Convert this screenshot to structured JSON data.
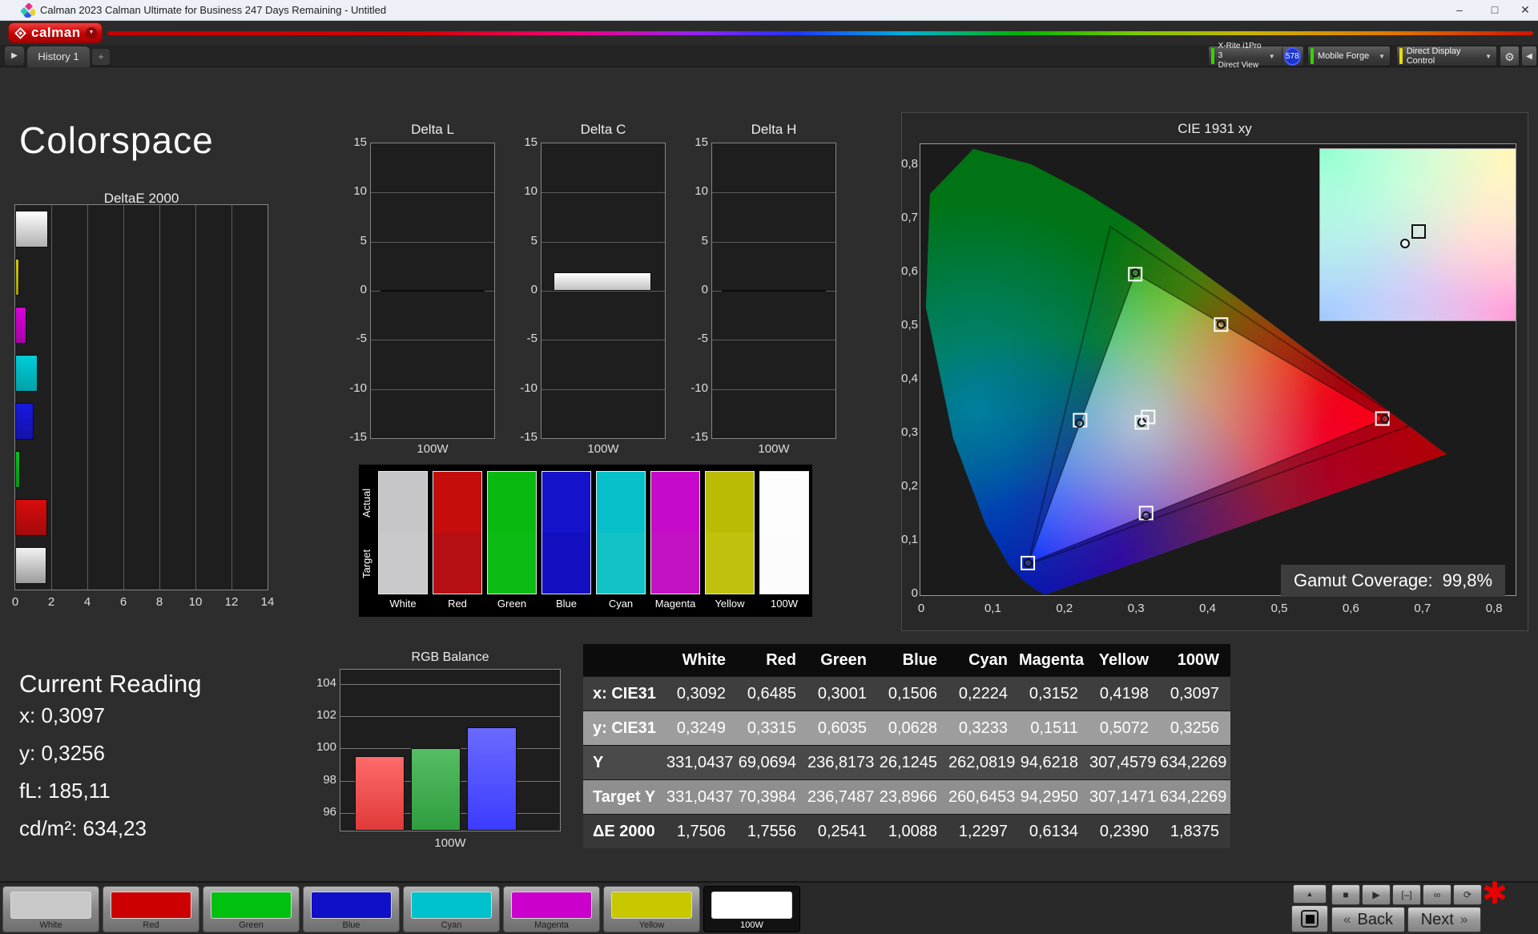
{
  "window": {
    "title": "Calman 2023 Calman Ultimate for Business 247 Days Remaining  - Untitled",
    "minimize": "–",
    "maximize": "□",
    "close": "✕"
  },
  "brand": {
    "name": "calman",
    "dropdown": "▼"
  },
  "tab_bar": {
    "expander": "▶",
    "tab": "History 1",
    "add": "+",
    "meter": {
      "line1": "X-Rite i1Pro 3",
      "line2": "Direct View",
      "badge": "578",
      "dropdown": "▼",
      "accent": "#35d400"
    },
    "pattern_source": {
      "label": "Mobile Forge",
      "dropdown": "▼",
      "accent": "#35d400"
    },
    "display_control": {
      "label": "Direct Display Control",
      "dropdown": "▼",
      "accent": "#f0dc00"
    },
    "gear": "⚙",
    "collapse": "◀"
  },
  "page_title": "Colorspace",
  "deltae_chart": {
    "type": "bar",
    "title": "DeltaE 2000",
    "xlim": [
      0,
      14
    ],
    "x_ticks": [
      "0",
      "2",
      "4",
      "6",
      "8",
      "10",
      "12",
      "14"
    ],
    "bars_top_to_bottom": [
      {
        "label": "100W",
        "value": 1.8375,
        "c1": "#ffffff",
        "c2": "#b0b0b0"
      },
      {
        "label": "Yellow",
        "value": 0.239,
        "c1": "#d8ca00",
        "c2": "#a89e00"
      },
      {
        "label": "Magenta",
        "value": 0.6134,
        "c1": "#d800d8",
        "c2": "#a800a8"
      },
      {
        "label": "Cyan",
        "value": 1.2297,
        "c1": "#00ccd8",
        "c2": "#00a2aa"
      },
      {
        "label": "Blue",
        "value": 1.0088,
        "c1": "#1818e0",
        "c2": "#1212a8"
      },
      {
        "label": "Green",
        "value": 0.2541,
        "c1": "#00c61e",
        "c2": "#009a16"
      },
      {
        "label": "Red",
        "value": 1.7556,
        "c1": "#d80c0c",
        "c2": "#a40a0a"
      },
      {
        "label": "White",
        "value": 1.7506,
        "c1": "#f2f2f2",
        "c2": "#9c9c9c"
      }
    ]
  },
  "delta_charts": {
    "ylim": [
      -15,
      15
    ],
    "y_ticks": [
      "15",
      "10",
      "5",
      "0",
      "-5",
      "-10",
      "-15"
    ],
    "x_label": "100W",
    "charts": [
      {
        "title": "Delta L",
        "value": 0
      },
      {
        "title": "Delta C",
        "value": 1.9
      },
      {
        "title": "Delta H",
        "value": 0
      }
    ]
  },
  "swatches": {
    "row_labels": [
      "Actual",
      "Target"
    ],
    "items": [
      {
        "label": "White",
        "actual": "#c6c6c8",
        "target": "#c9c9cb"
      },
      {
        "label": "Red",
        "actual": "#c50d0d",
        "target": "#b60f13"
      },
      {
        "label": "Green",
        "actual": "#09b90f",
        "target": "#0cbb13"
      },
      {
        "label": "Blue",
        "actual": "#1512cb",
        "target": "#1310c1"
      },
      {
        "label": "Cyan",
        "actual": "#06c0ca",
        "target": "#12c2c4"
      },
      {
        "label": "Magenta",
        "actual": "#c709c9",
        "target": "#c312c3"
      },
      {
        "label": "Yellow",
        "actual": "#b9bb04",
        "target": "#c0c10c"
      },
      {
        "label": "100W",
        "actual": "#fdfdfd",
        "target": "#fcfcfc"
      }
    ]
  },
  "cie": {
    "title": "CIE 1931 xy",
    "x_ticks": [
      "0",
      "0,1",
      "0,2",
      "0,3",
      "0,4",
      "0,5",
      "0,6",
      "0,7",
      "0,8"
    ],
    "y_ticks": [
      "0,8",
      "0,7",
      "0,6",
      "0,5",
      "0,4",
      "0,3",
      "0,2",
      "0,1",
      "0"
    ],
    "gamut_label": "Gamut Coverage:",
    "gamut_value": "99,8%",
    "markers": [
      {
        "name": "green",
        "sx": 0.3,
        "sy": 0.601,
        "mx": 0.3001,
        "my": 0.6035
      },
      {
        "name": "yellow",
        "sx": 0.4198,
        "sy": 0.5072,
        "mx": 0.4198,
        "my": 0.5072
      },
      {
        "name": "cyan",
        "sx": 0.223,
        "sy": 0.329,
        "mx": 0.2224,
        "my": 0.3233
      },
      {
        "name": "white",
        "sx": 0.3092,
        "sy": 0.3249,
        "mx": 0.3092,
        "my": 0.3249
      },
      {
        "name": "white-2",
        "sx": 0.318,
        "sy": 0.335,
        "mx": null,
        "my": null
      },
      {
        "name": "red",
        "sx": 0.645,
        "sy": 0.332,
        "mx": 0.6485,
        "my": 0.3315
      },
      {
        "name": "magenta",
        "sx": 0.3152,
        "sy": 0.156,
        "mx": 0.3152,
        "my": 0.1511
      },
      {
        "name": "blue",
        "sx": 0.15,
        "sy": 0.0628,
        "mx": 0.1506,
        "my": 0.0628
      }
    ]
  },
  "current_reading": {
    "title": "Current Reading",
    "lines": [
      "x: 0,3097",
      "y: 0,3256",
      "fL: 185,11",
      "cd/m²: 634,23"
    ]
  },
  "rgb_balance": {
    "type": "bar",
    "title": "RGB Balance",
    "x_label": "100W",
    "ylim": [
      94.9,
      104.9
    ],
    "y_ticks": [
      "104",
      "102",
      "100",
      "98",
      "96"
    ],
    "y_tick_values": [
      104,
      102,
      100,
      98,
      96
    ],
    "series": [
      {
        "name": "Red",
        "value": 99.55,
        "c1": "#ff6a6a",
        "c2": "#e03a3a"
      },
      {
        "name": "Green",
        "value": 100.0,
        "c1": "#55bd62",
        "c2": "#2f9e3f"
      },
      {
        "name": "Blue",
        "value": 101.3,
        "c1": "#6a6aff",
        "c2": "#3c3cff"
      }
    ]
  },
  "data_table": {
    "columns": [
      "White",
      "Red",
      "Green",
      "Blue",
      "Cyan",
      "Magenta",
      "Yellow",
      "100W"
    ],
    "rows": [
      {
        "label": "x: CIE31",
        "bg": "#3e3e3e",
        "values": [
          "0,3092",
          "0,6485",
          "0,3001",
          "0,1506",
          "0,2224",
          "0,3152",
          "0,4198",
          "0,3097"
        ]
      },
      {
        "label": "y: CIE31",
        "bg": "#9d9d9d",
        "values": [
          "0,3249",
          "0,3315",
          "0,6035",
          "0,0628",
          "0,3233",
          "0,1511",
          "0,5072",
          "0,3256"
        ]
      },
      {
        "label": "Y",
        "bg": "#4a4a4a",
        "values": [
          "331,0437",
          "69,0694",
          "236,8173",
          "26,1245",
          "262,0819",
          "94,6218",
          "307,4579",
          "634,2269"
        ]
      },
      {
        "label": "Target Y",
        "bg": "#8f8f8f",
        "values": [
          "331,0437",
          "70,3984",
          "236,7487",
          "23,8966",
          "260,6453",
          "94,2950",
          "307,1471",
          "634,2269"
        ]
      },
      {
        "label": "ΔE 2000",
        "bg": "#383838",
        "values": [
          "1,7506",
          "1,7556",
          "0,2541",
          "1,0088",
          "1,2297",
          "0,6134",
          "0,2390",
          "1,8375"
        ]
      }
    ]
  },
  "bottom_bar": {
    "patches": [
      {
        "label": "White",
        "color": "#c8c8c8",
        "selected": false
      },
      {
        "label": "Red",
        "color": "#cc0000",
        "selected": false
      },
      {
        "label": "Green",
        "color": "#00c010",
        "selected": false
      },
      {
        "label": "Blue",
        "color": "#1010c8",
        "selected": false
      },
      {
        "label": "Cyan",
        "color": "#00c2cc",
        "selected": false
      },
      {
        "label": "Magenta",
        "color": "#cc00cc",
        "selected": false
      },
      {
        "label": "Yellow",
        "color": "#c8c800",
        "selected": false
      },
      {
        "label": "100W",
        "color": "#ffffff",
        "selected": true
      }
    ],
    "transport": {
      "eject": "▲",
      "icons": [
        "■",
        "▶",
        "[–]",
        "∞",
        "⟳"
      ],
      "alert": "✱"
    },
    "back": {
      "icon": "«",
      "label": "Back"
    },
    "next": {
      "label": "Next",
      "icon": "»"
    }
  }
}
